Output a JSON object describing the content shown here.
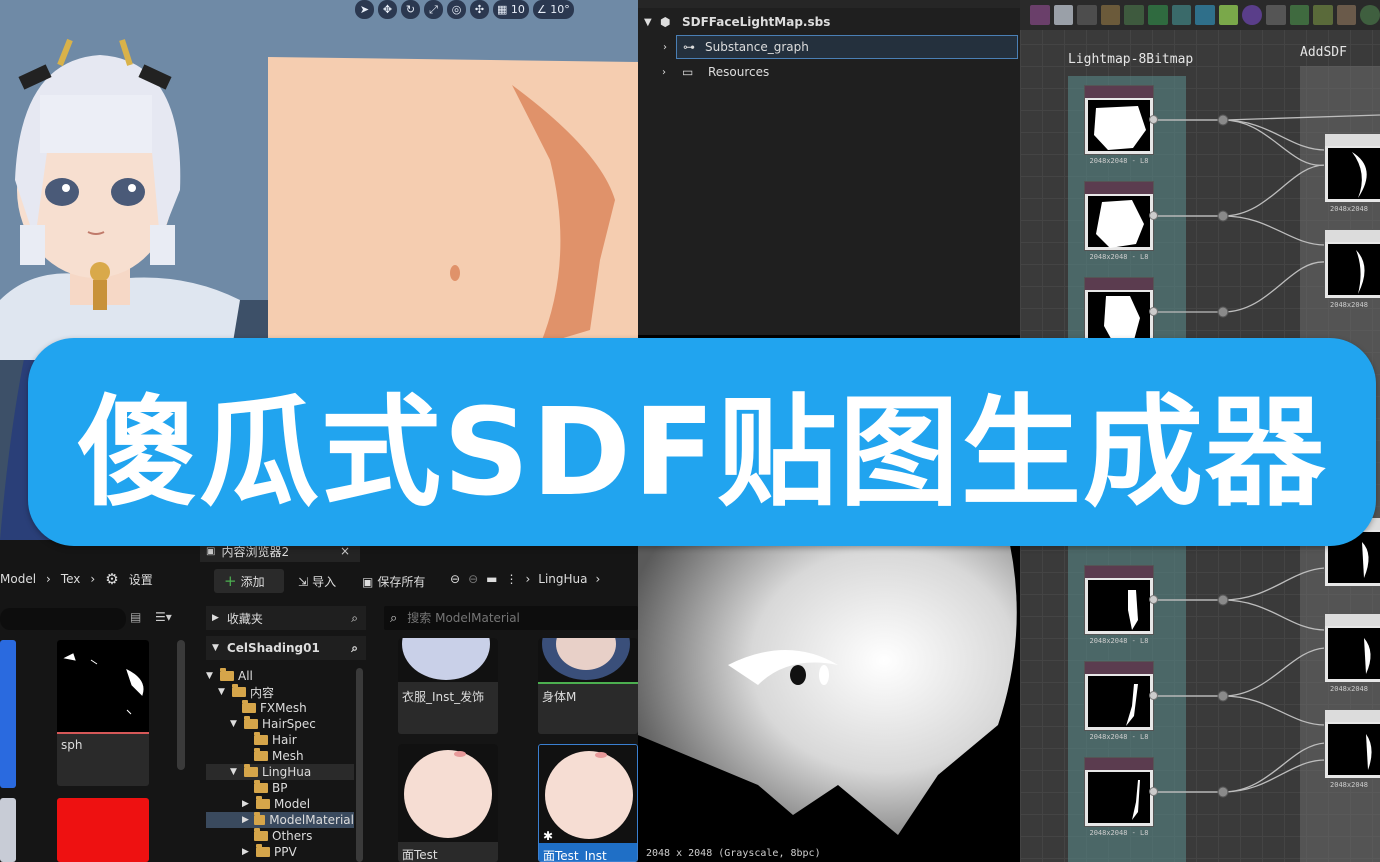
{
  "viewport": {
    "toolbar": {
      "select_icon": "pointer-icon",
      "move_icon": "move-icon",
      "rotate_icon": "rotate-icon",
      "scale_icon": "scale-icon",
      "grid_value": "10",
      "angle_value": "10°"
    }
  },
  "explorer": {
    "package": "SDFFaceLightMap.sbs",
    "items": [
      {
        "label": "Substance_graph",
        "icon": "graph-icon",
        "selected": true
      },
      {
        "label": "Resources",
        "icon": "folder-icon",
        "selected": false
      }
    ]
  },
  "view2d": {
    "status": "2048 x 2048 (Grayscale, 8bpc)"
  },
  "graph": {
    "frames": [
      {
        "label": "Lightmap-8Bitmap"
      },
      {
        "label": "AddSDF"
      }
    ],
    "node_caption": "2048x2048 - L8",
    "node_caption_right": "2048x2048"
  },
  "content_browser_left": {
    "breadcrumb": [
      "Model",
      "Tex"
    ],
    "settings_label": "设置",
    "items": [
      {
        "label": "sph"
      }
    ]
  },
  "content_browser": {
    "tab_title": "内容浏览器2",
    "add_label": "添加",
    "import_label": "导入",
    "save_all_label": "保存所有",
    "path_label": "LingHua",
    "favorites_label": "收藏夹",
    "project_label": "CelShading01",
    "search_placeholder": "搜索 ModelMaterial",
    "tree": [
      {
        "label": "All",
        "depth": 0,
        "selected": false
      },
      {
        "label": "内容",
        "depth": 1,
        "selected": false
      },
      {
        "label": "FXMesh",
        "depth": 2,
        "selected": false
      },
      {
        "label": "HairSpec",
        "depth": 2,
        "selected": false
      },
      {
        "label": "Hair",
        "depth": 3,
        "selected": false
      },
      {
        "label": "Mesh",
        "depth": 3,
        "selected": false
      },
      {
        "label": "LingHua",
        "depth": 2,
        "selected": false
      },
      {
        "label": "BP",
        "depth": 3,
        "selected": false
      },
      {
        "label": "Model",
        "depth": 3,
        "selected": false
      },
      {
        "label": "ModelMaterial",
        "depth": 3,
        "selected": true
      },
      {
        "label": "Others",
        "depth": 3,
        "selected": false
      },
      {
        "label": "PPV",
        "depth": 3,
        "selected": false
      }
    ],
    "assets": [
      {
        "label": "衣服_Inst_发饰"
      },
      {
        "label": "身体M"
      },
      {
        "label": "面Test"
      },
      {
        "label": "面Test_Inst"
      }
    ]
  },
  "banner": {
    "title": "傻瓜式SDF贴图生成器"
  }
}
